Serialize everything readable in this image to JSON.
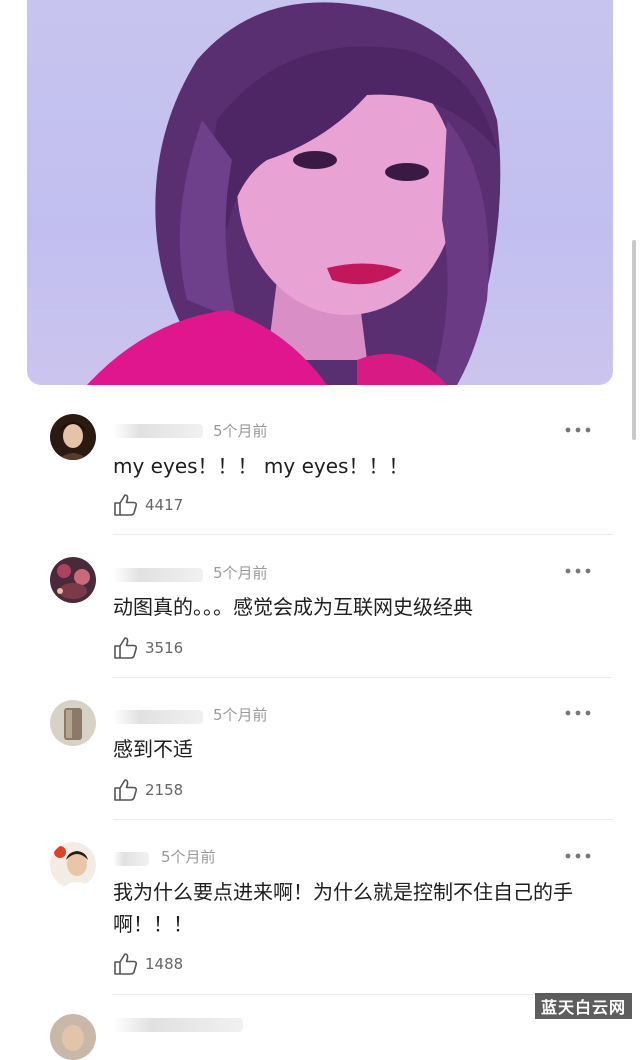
{
  "media": {
    "icon": "gif-photo"
  },
  "comments": [
    {
      "time": "5个月前",
      "text": "my eyes！！！ my eyes！！！",
      "likes": "4417"
    },
    {
      "time": "5个月前",
      "text": "动图真的。。。感觉会成为互联网史级经典",
      "likes": "3516"
    },
    {
      "time": "5个月前",
      "text": "感到不适",
      "likes": "2158"
    },
    {
      "time": "5个月前",
      "text": "我为什么要点进来啊！为什么就是控制不住自己的手啊！！！",
      "likes": "1488"
    }
  ],
  "icons": {
    "more": "more-dots-icon",
    "like": "thumbs-up-icon"
  },
  "watermark": "蓝天白云网",
  "colors": {
    "hero_bg": "#c7c4ef",
    "jacket": "#e0168f",
    "text": "#1e1e1e",
    "muted": "#9a9a9a"
  }
}
